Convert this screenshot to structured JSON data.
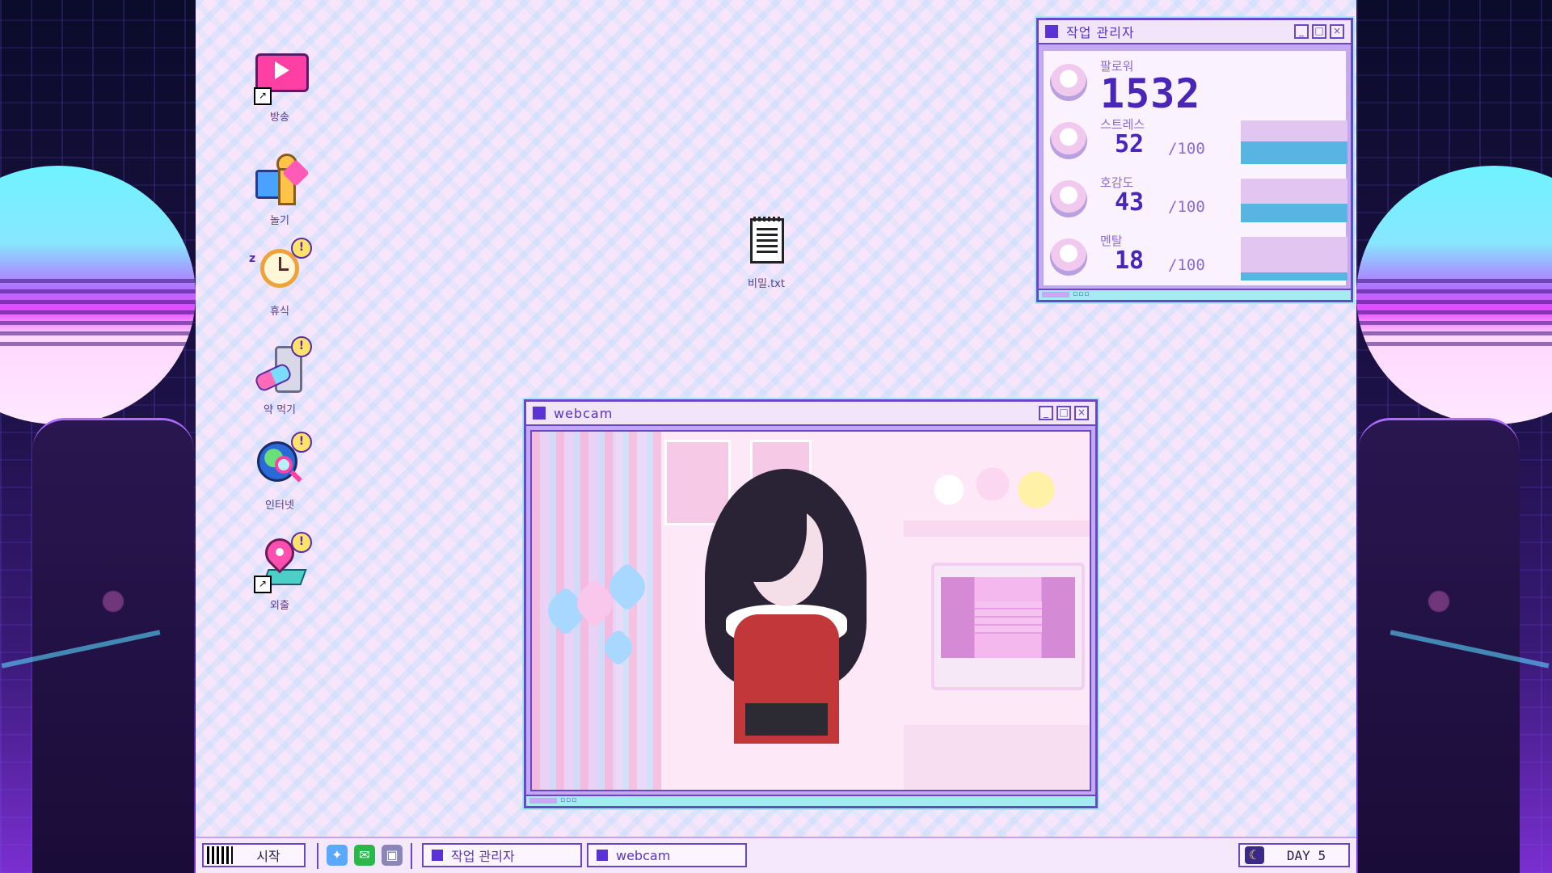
{
  "desktop_icons": [
    {
      "label": "방송",
      "icon": "stream-play-icon",
      "badge": "",
      "shortcut": true
    },
    {
      "label": "놀기",
      "icon": "puzzle-game-icon",
      "badge": "",
      "shortcut": false
    },
    {
      "label": "휴식",
      "icon": "alarm-clock-icon",
      "badge": "!",
      "shortcut": false
    },
    {
      "label": "약 먹기",
      "icon": "pills-icon",
      "badge": "!",
      "shortcut": false
    },
    {
      "label": "인터넷",
      "icon": "globe-search-icon",
      "badge": "!",
      "shortcut": false
    },
    {
      "label": "외출",
      "icon": "map-pin-icon",
      "badge": "!",
      "shortcut": true
    }
  ],
  "file_icon": {
    "label": "비밀.txt",
    "icon": "text-file-icon"
  },
  "task_manager": {
    "title": "작업 관리자",
    "followers": {
      "label": "팔로워",
      "value": "1532"
    },
    "stats": [
      {
        "label": "스트레스",
        "value": "52",
        "max": "/100",
        "level": 0.52
      },
      {
        "label": "호감도",
        "value": "43",
        "max": "/100",
        "level": 0.43
      },
      {
        "label": "멘탈",
        "value": "18",
        "max": "/100",
        "level": 0.18
      }
    ],
    "status_dots": "▫▫▫"
  },
  "webcam": {
    "title": "webcam",
    "status_dots": "▫▫▫"
  },
  "window_buttons": {
    "minimize": "_",
    "maximize": "□",
    "close": "×"
  },
  "taskbar": {
    "start_label": "시작",
    "quick_icons": [
      "twitter-icon",
      "chat-icon",
      "computer-icon"
    ],
    "tasks": [
      "작업 관리자",
      "webcam"
    ],
    "day_label": "DAY 5",
    "day_icon": "moon-icon"
  },
  "colors": {
    "accent": "#6a47c8",
    "title_square": "#5a33d6",
    "bar_fill": "#58b4e3",
    "bar_bg": "#e3c5f2",
    "highlight": "#ffe36a"
  }
}
